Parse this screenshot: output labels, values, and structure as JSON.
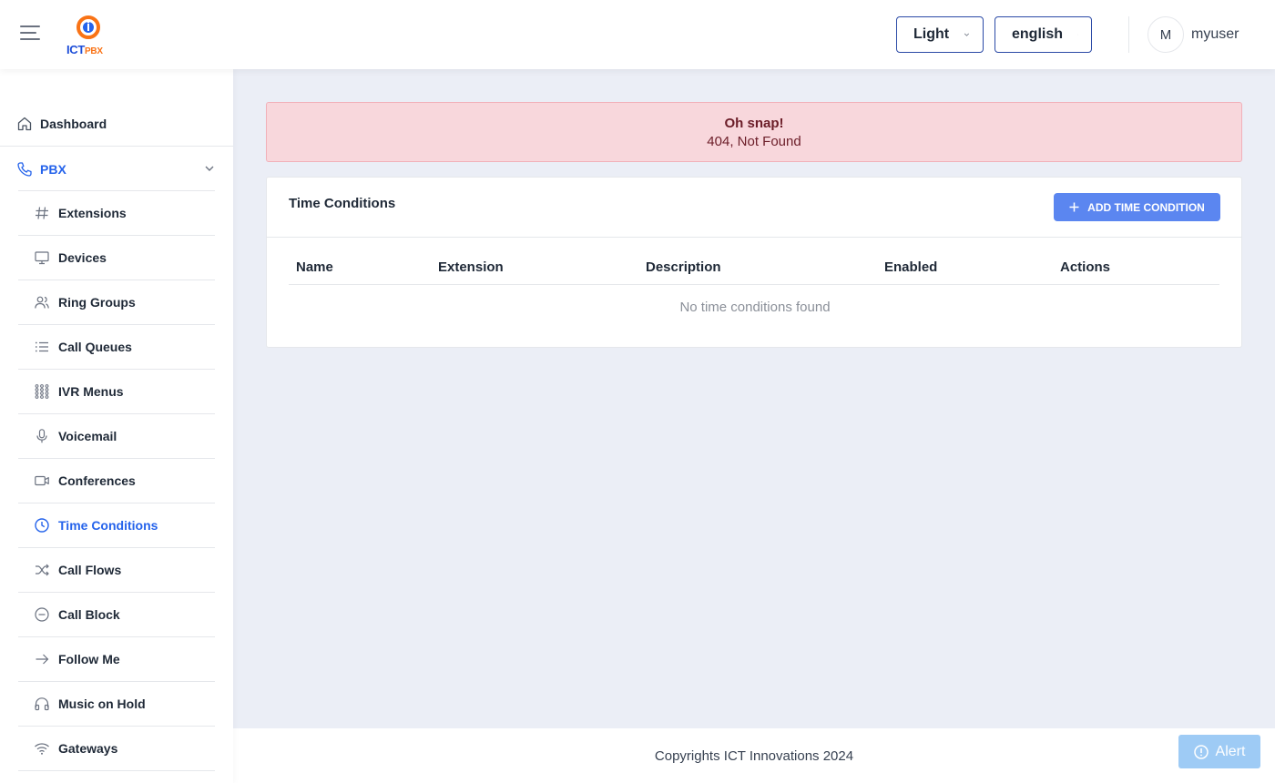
{
  "header": {
    "logo_text_ict": "ICT",
    "logo_text_pbx": "PBX",
    "theme_select": "Light",
    "language_select": "english",
    "avatar_initial": "M",
    "username": "myuser"
  },
  "sidebar": {
    "dashboard": {
      "label": "Dashboard",
      "icon": "home-icon"
    },
    "pbx": {
      "label": "PBX",
      "icon": "phone-icon"
    },
    "items": [
      {
        "label": "Extensions",
        "icon": "hash-icon"
      },
      {
        "label": "Devices",
        "icon": "monitor-icon"
      },
      {
        "label": "Ring Groups",
        "icon": "users-icon"
      },
      {
        "label": "Call Queues",
        "icon": "list-icon"
      },
      {
        "label": "IVR Menus",
        "icon": "grid-dots-icon"
      },
      {
        "label": "Voicemail",
        "icon": "microphone-icon"
      },
      {
        "label": "Conferences",
        "icon": "video-icon"
      },
      {
        "label": "Time Conditions",
        "icon": "clock-icon",
        "active": true
      },
      {
        "label": "Call Flows",
        "icon": "shuffle-icon"
      },
      {
        "label": "Call Block",
        "icon": "minus-circle-icon"
      },
      {
        "label": "Follow Me",
        "icon": "arrow-right-icon"
      },
      {
        "label": "Music on Hold",
        "icon": "headphones-icon"
      },
      {
        "label": "Gateways",
        "icon": "wifi-icon"
      }
    ]
  },
  "alert": {
    "title": "Oh snap!",
    "message": "404, Not Found"
  },
  "card": {
    "title": "Time Conditions",
    "add_button": "ADD TIME CONDITION",
    "columns": [
      "Name",
      "Extension",
      "Description",
      "Enabled",
      "Actions"
    ],
    "empty_text": "No time conditions found"
  },
  "footer": {
    "copyright": "Copyrights ICT Innovations 2024",
    "alert_button": "Alert"
  },
  "colors": {
    "accent": "#2563eb",
    "button": "#5b86f0",
    "error_bg": "#f8d7dc",
    "page_bg": "#ebeef6"
  }
}
